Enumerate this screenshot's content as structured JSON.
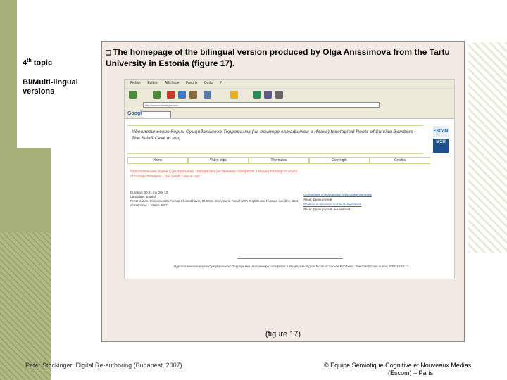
{
  "sidebar": {
    "topic_number": "4",
    "topic_suffix": "th",
    "topic_label": " topic",
    "sub_topic": "Bi/Multi-lingual versions"
  },
  "slide": {
    "heading": "The homepage of the bilingual version produced by Olga Anissimova from the Tartu University in Estonia (figure 17).",
    "bullet_icon": "square-bullet-icon",
    "caption": "(figure 17)"
  },
  "browser": {
    "menu": [
      "Fichier",
      "Edition",
      "Affichage",
      "Favoris",
      "Outils",
      "?"
    ],
    "address_value": "http://www.semiotique.net/...",
    "google_label": "Google",
    "toolbar_icons": [
      "back-icon",
      "forward-icon",
      "stop-icon",
      "refresh-icon",
      "home-icon",
      "search-icon",
      "favorites-icon",
      "history-icon",
      "mail-icon",
      "print-icon"
    ]
  },
  "website": {
    "banner_title": "Идеологические Корни Суицидального Терроризма (на примере сатафитов в Ираке) Ideological Roots of Suicide Bombers - The Salafi Case in Iraq",
    "logo_top": "ESCoM",
    "logo_bottom": "MSH",
    "nav": [
      "Home",
      "Video clips",
      "Thematics",
      "Copyright",
      "Credits"
    ],
    "content_title": "Идеологические Корни Суицидального Терроризма (на примере сатафитов в Ираке) Ideological Roots of Suicide Bombers - The Salafi Case in Iraq",
    "meta_duration": "Duration: 00:21 mn 20s 13",
    "meta_language": "Language: English",
    "meta_presentation": "Presentation: Interview with Farhad Khosrokhavar, EHESS. Interview in French with English and Russian subtitles. Date of interview: 1 March 2007",
    "links": [
      {
        "text": "Отношение к терроризму и фундаментализму",
        "sub": "Язык: французский"
      },
      {
        "text": "Relation to terrorism and fundamentalism",
        "sub": "Язык: французский, английский"
      }
    ],
    "footer": "Идеологические Корни Суицидального Терроризма (на примере сатафитов в Ираке) Ideological Roots of Suicide Bombers - The Salafi Case in Iraq 2007 10:25:12"
  },
  "footer": {
    "left": "Peter Stockinger: Digital Re-authoring (Budapest, 2007)",
    "right_prefix": "© Equipe Sémiotique Cognitive et Nouveaux Médias",
    "right_link_open": "(",
    "right_link": "Escom",
    "right_suffix": ") – Paris"
  },
  "colors": {
    "sidebar": "#a8b07a",
    "card": "#f3ebe3",
    "accent_green": "#c9d98d"
  }
}
